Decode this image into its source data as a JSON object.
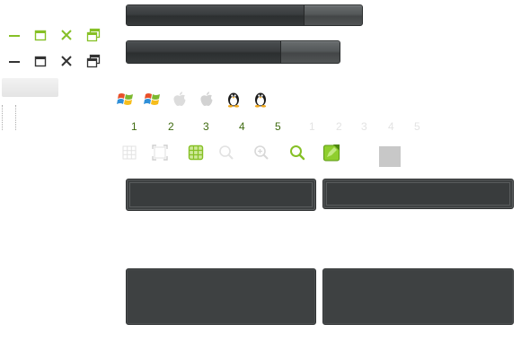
{
  "progress_bars": [
    {
      "name": "progress-bar-1",
      "value_percent": 75
    },
    {
      "name": "progress-bar-2",
      "value_percent": 72
    }
  ],
  "window_controls": {
    "green": [
      "minimize-icon",
      "maximize-icon",
      "close-icon",
      "restore-icon"
    ],
    "dark": [
      "minimize-icon",
      "maximize-icon",
      "close-icon",
      "restore-icon"
    ],
    "colors": {
      "green": "#86c026",
      "dark": "#333333"
    }
  },
  "os_icons": [
    "windows-icon",
    "windows-icon",
    "apple-icon",
    "apple-icon",
    "linux-tux-icon",
    "linux-tux-icon"
  ],
  "pagination": {
    "active": [
      "1",
      "2",
      "3",
      "4",
      "5"
    ],
    "inactive": [
      "1",
      "2",
      "3",
      "4",
      "5"
    ]
  },
  "tool_icons": [
    "grid-icon",
    "fullscreen-icon",
    "grid-icon",
    "zoom-in-icon",
    "zoom-in-icon",
    "search-icon",
    "edit-icon"
  ],
  "colors": {
    "accent_green": "#86c026",
    "pagination_green": "#3f6b10",
    "panel_dark": "#3e4142"
  }
}
